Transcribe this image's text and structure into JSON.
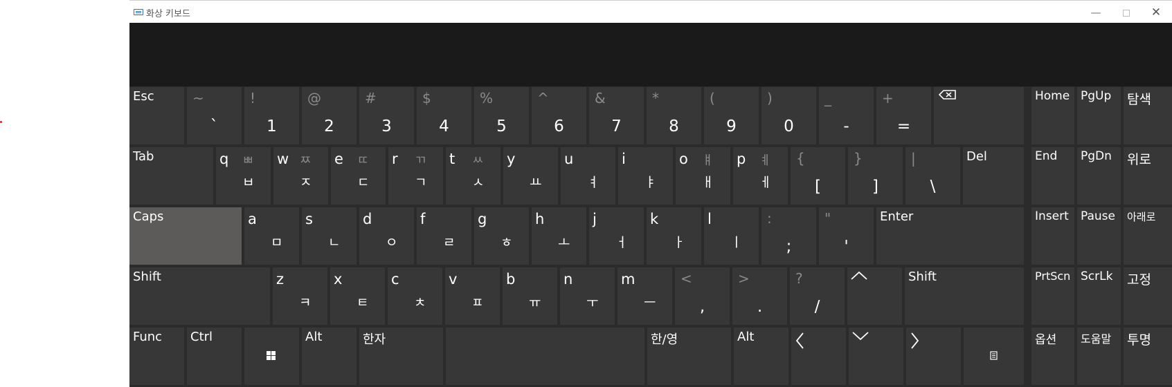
{
  "window": {
    "title": "화상 키보드",
    "minimize": "—",
    "close": "✕"
  },
  "keys": {
    "esc": "Esc",
    "backtick": {
      "shift": "~",
      "main": "`"
    },
    "n1": {
      "shift": "!",
      "main": "1"
    },
    "n2": {
      "shift": "@",
      "main": "2"
    },
    "n3": {
      "shift": "#",
      "main": "3"
    },
    "n4": {
      "shift": "$",
      "main": "4"
    },
    "n5": {
      "shift": "%",
      "main": "5"
    },
    "n6": {
      "shift": "^",
      "main": "6"
    },
    "n7": {
      "shift": "&",
      "main": "7"
    },
    "n8": {
      "shift": "*",
      "main": "8"
    },
    "n9": {
      "shift": "(",
      "main": "9"
    },
    "n0": {
      "shift": ")",
      "main": "0"
    },
    "minus": {
      "shift": "_",
      "main": "-"
    },
    "equal": {
      "shift": "+",
      "main": "="
    },
    "tab": "Tab",
    "q": {
      "letter": "q",
      "shift": "ㅃ",
      "main": "ㅂ"
    },
    "w": {
      "letter": "w",
      "shift": "ㅉ",
      "main": "ㅈ"
    },
    "e": {
      "letter": "e",
      "shift": "ㄸ",
      "main": "ㄷ"
    },
    "r": {
      "letter": "r",
      "shift": "ㄲ",
      "main": "ㄱ"
    },
    "t": {
      "letter": "t",
      "shift": "ㅆ",
      "main": "ㅅ"
    },
    "y": {
      "letter": "y",
      "main": "ㅛ"
    },
    "u": {
      "letter": "u",
      "main": "ㅕ"
    },
    "i": {
      "letter": "i",
      "main": "ㅑ"
    },
    "o": {
      "letter": "o",
      "shift": "ㅒ",
      "main": "ㅐ"
    },
    "p": {
      "letter": "p",
      "shift": "ㅖ",
      "main": "ㅔ"
    },
    "lbracket": {
      "shift": "{",
      "main": "["
    },
    "rbracket": {
      "shift": "}",
      "main": "]"
    },
    "backslash": {
      "shift": "|",
      "main": "\\"
    },
    "del": "Del",
    "caps": "Caps",
    "a": {
      "letter": "a",
      "main": "ㅁ"
    },
    "s": {
      "letter": "s",
      "main": "ㄴ"
    },
    "d": {
      "letter": "d",
      "main": "ㅇ"
    },
    "f": {
      "letter": "f",
      "main": "ㄹ"
    },
    "g": {
      "letter": "g",
      "main": "ㅎ"
    },
    "h": {
      "letter": "h",
      "main": "ㅗ"
    },
    "j": {
      "letter": "j",
      "main": "ㅓ"
    },
    "k": {
      "letter": "k",
      "main": "ㅏ"
    },
    "l": {
      "letter": "l",
      "main": "ㅣ"
    },
    "semicolon": {
      "shift": ":",
      "main": ";"
    },
    "quote": {
      "shift": "\"",
      "main": "'"
    },
    "enter": "Enter",
    "lshift": "Shift",
    "z": {
      "letter": "z",
      "main": "ㅋ"
    },
    "x": {
      "letter": "x",
      "main": "ㅌ"
    },
    "c": {
      "letter": "c",
      "main": "ㅊ"
    },
    "v": {
      "letter": "v",
      "main": "ㅍ"
    },
    "b": {
      "letter": "b",
      "main": "ㅠ"
    },
    "n": {
      "letter": "n",
      "main": "ㅜ"
    },
    "m": {
      "letter": "m",
      "main": "ㅡ"
    },
    "comma": {
      "shift": "<",
      "main": ","
    },
    "period": {
      "shift": ">",
      "main": "."
    },
    "slash": {
      "shift": "?",
      "main": "/"
    },
    "rshift": "Shift",
    "func": "Func",
    "ctrl": "Ctrl",
    "alt": "Alt",
    "hanja": "한자",
    "hanyeong": "한/영",
    "ralt": "Alt",
    "home": "Home",
    "pgup": "PgUp",
    "search": "탐색",
    "end": "End",
    "pgdn": "PgDn",
    "up": "위로",
    "insert": "Insert",
    "pause": "Pause",
    "down": "아래로",
    "prtscn": "PrtScn",
    "scrlk": "ScrLk",
    "dock": "고정",
    "options": "옵션",
    "help": "도움말",
    "fade": "투명"
  }
}
